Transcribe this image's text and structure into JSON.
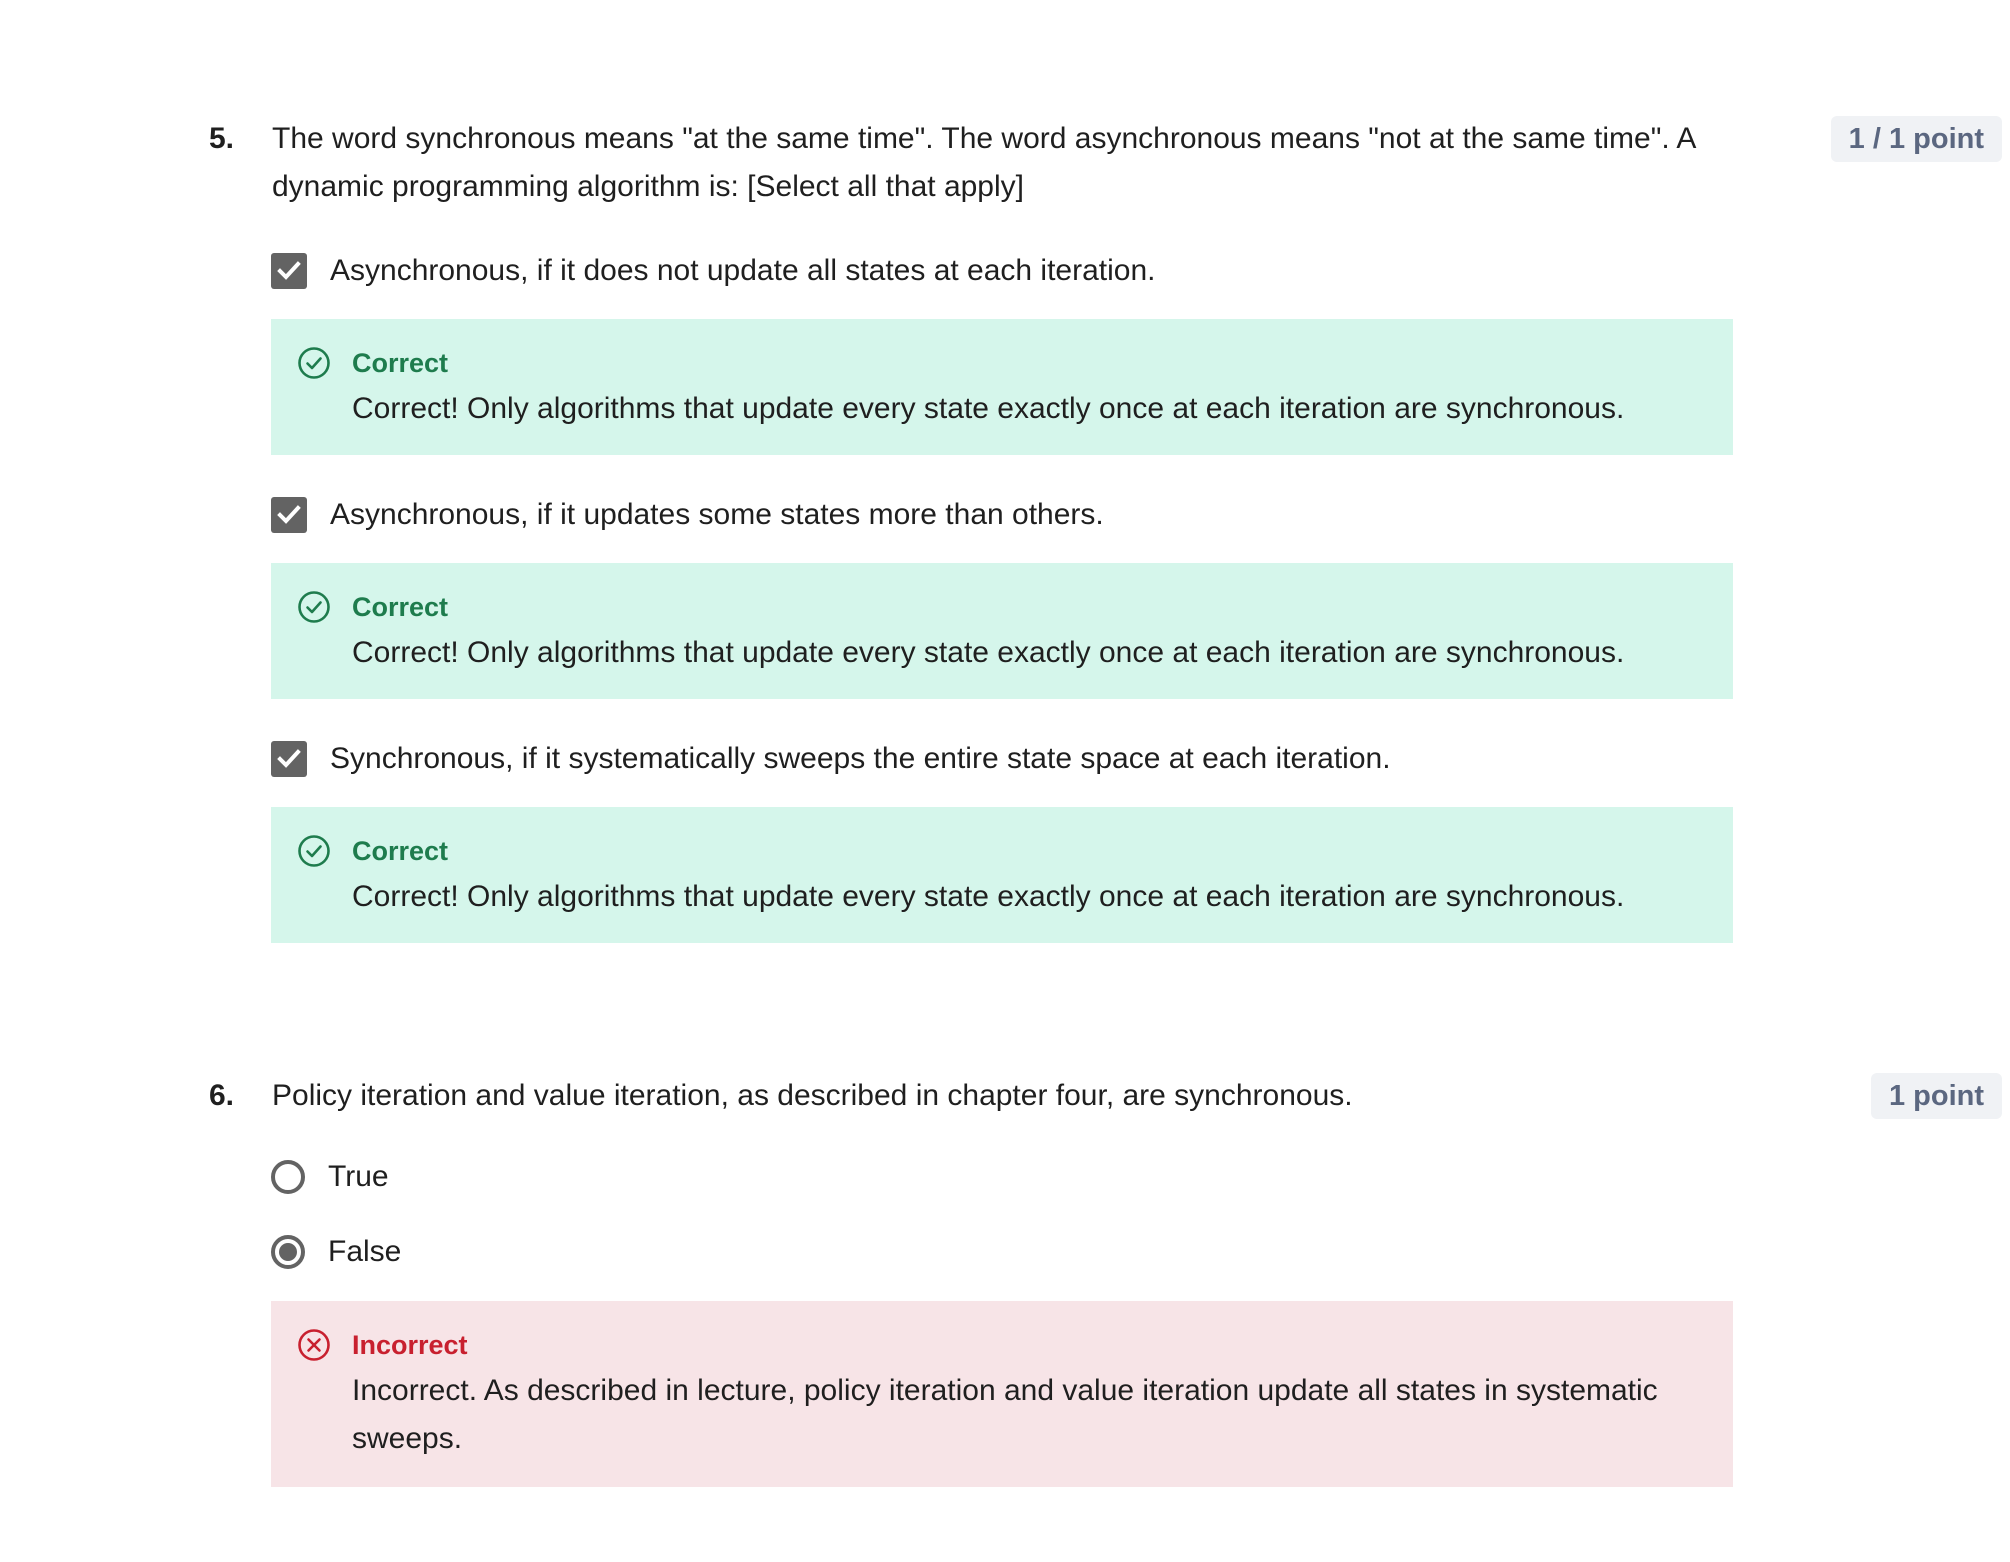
{
  "questions": [
    {
      "number": "5.",
      "text": "The word synchronous means \"at the same time\". The word asynchronous means \"not at the same time\". A dynamic programming algorithm is: [Select all that apply]",
      "points": "1 / 1 point",
      "input_type": "checkbox",
      "options": [
        {
          "label": "Asynchronous, if it does not update all states at each iteration.",
          "checked": true,
          "feedback": {
            "status": "correct",
            "title": "Correct",
            "text": "Correct! Only algorithms that update every state exactly once at each iteration are synchronous."
          }
        },
        {
          "label": "Asynchronous, if it updates some states more than others.",
          "checked": true,
          "feedback": {
            "status": "correct",
            "title": "Correct",
            "text": "Correct! Only algorithms that update every state exactly once at each iteration are synchronous."
          }
        },
        {
          "label": "Synchronous, if it systematically sweeps the entire state space at each iteration.",
          "checked": true,
          "feedback": {
            "status": "correct",
            "title": "Correct",
            "text": "Correct! Only algorithms that update every state exactly once at each iteration are synchronous."
          }
        }
      ]
    },
    {
      "number": "6.",
      "text": "Policy iteration and value iteration, as described in chapter four, are synchronous.",
      "points": "1 point",
      "input_type": "radio",
      "options": [
        {
          "label": "True",
          "selected": false
        },
        {
          "label": "False",
          "selected": true
        }
      ],
      "feedback": {
        "status": "incorrect",
        "title": "Incorrect",
        "text": "Incorrect. As described in lecture, policy iteration and value iteration update all states in systematic sweeps."
      }
    }
  ],
  "colors": {
    "correct_bg": "#d5f6eb",
    "correct_accent": "#1e7c4d",
    "incorrect_bg": "#f7e4e7",
    "incorrect_accent": "#c8202f",
    "control_gray": "#636363",
    "badge_bg": "#f0f2f5",
    "badge_text": "#5b6780"
  },
  "icons": {
    "checkbox": "checkmark-icon",
    "correct": "check-circle-icon",
    "incorrect": "x-circle-icon"
  }
}
